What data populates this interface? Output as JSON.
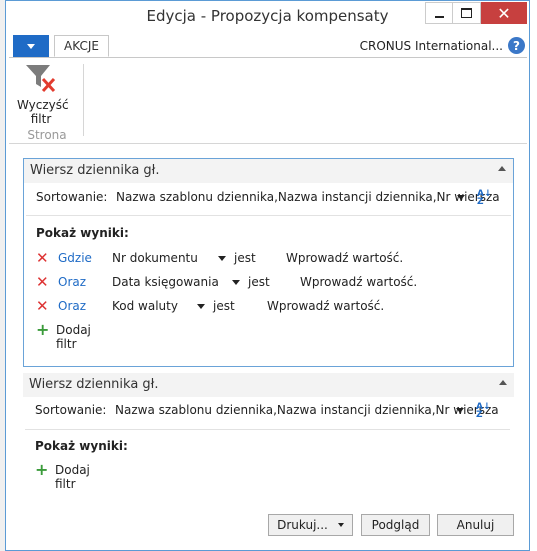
{
  "window": {
    "title": "Edycja - Propozycja kompensaty"
  },
  "ribbon": {
    "tab_akcje": "AKCJE",
    "company": "CRONUS International...",
    "help_icon": "?",
    "clear_filter_label_line1": "Wyczyść",
    "clear_filter_label_line2": "filtr",
    "group_label": "Strona"
  },
  "section1": {
    "title": "Wiersz dziennika gł.",
    "sort_label": "Sortowanie:",
    "sort_value": "Nazwa szablonu dziennika,Nazwa instancji dziennika,Nr wiersza",
    "show_results": "Pokaż wyniki:",
    "filters": [
      {
        "conj": "Gdzie",
        "field": "Nr dokumentu",
        "op": "jest",
        "value": "Wprowadź wartość."
      },
      {
        "conj": "Oraz",
        "field": "Data księgowania",
        "op": "jest",
        "value": "Wprowadź wartość."
      },
      {
        "conj": "Oraz",
        "field": "Kod waluty",
        "op": "jest",
        "value": "Wprowadź wartość."
      }
    ],
    "add_filter": "Dodaj filtr"
  },
  "section2": {
    "title": "Wiersz dziennika gł.",
    "sort_label": "Sortowanie:",
    "sort_value": "Nazwa szablonu dziennika,Nazwa instancji dziennika,Nr wiersza",
    "show_results": "Pokaż wyniki:",
    "add_filter": "Dodaj filtr"
  },
  "footer": {
    "print": "Drukuj...",
    "preview": "Podgląd",
    "cancel": "Anuluj"
  },
  "colors": {
    "accent": "#1f6bc6",
    "close": "#c7403f",
    "remove": "#dd3333",
    "add": "#3b9b3b"
  }
}
